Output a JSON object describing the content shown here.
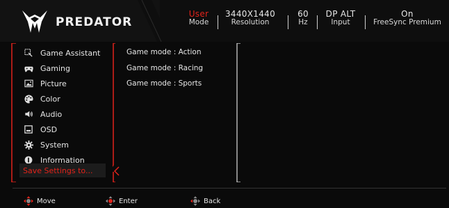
{
  "brand": {
    "name": "PREDATOR",
    "accent": "#e2231a"
  },
  "status": [
    {
      "top": "User",
      "bottom": "Mode"
    },
    {
      "top": "3440X1440",
      "bottom": "Resolution"
    },
    {
      "top": "60",
      "bottom": "Hz"
    },
    {
      "top": "DP ALT",
      "bottom": "Input"
    },
    {
      "top": "On",
      "bottom": "FreeSync Premium"
    }
  ],
  "menu": [
    {
      "label": "Game Assistant",
      "icon": "game-assistant-icon"
    },
    {
      "label": "Gaming",
      "icon": "gamepad-icon"
    },
    {
      "label": "Picture",
      "icon": "picture-icon"
    },
    {
      "label": "Color",
      "icon": "palette-icon"
    },
    {
      "label": "Audio",
      "icon": "speaker-icon"
    },
    {
      "label": "OSD",
      "icon": "osd-icon"
    },
    {
      "label": "System",
      "icon": "gear-icon"
    },
    {
      "label": "Information",
      "icon": "info-icon"
    }
  ],
  "save_settings": "Save Settings to...",
  "submenu": [
    "Game mode : Action",
    "Game mode : Racing",
    "Game mode : Sports"
  ],
  "footer": [
    {
      "label": "Move",
      "icon": "dpad-move-icon"
    },
    {
      "label": "Enter",
      "icon": "dpad-enter-icon"
    },
    {
      "label": "Back",
      "icon": "dpad-back-icon"
    }
  ]
}
